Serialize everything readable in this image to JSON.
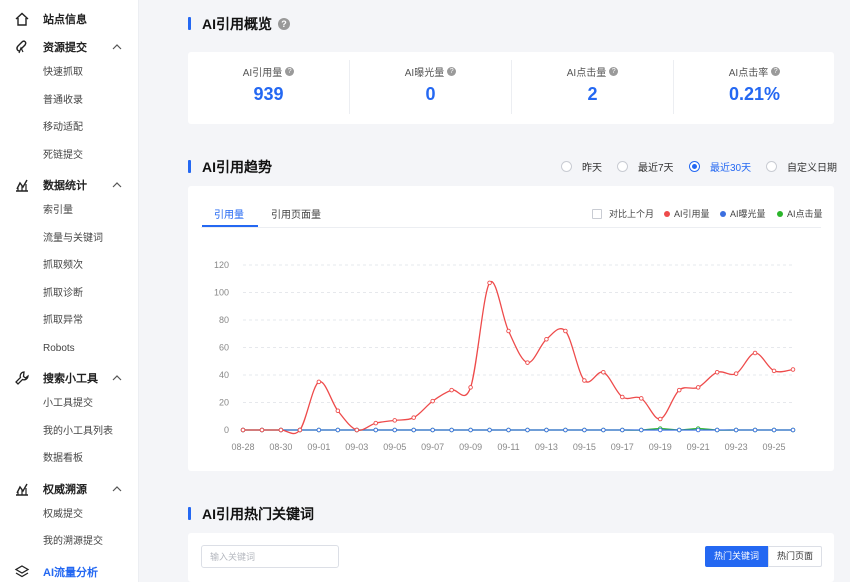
{
  "sidebar": {
    "groups": [
      {
        "label": "站点信息",
        "icon": "home-icon",
        "items": []
      },
      {
        "label": "资源提交",
        "icon": "submit-icon",
        "items": [
          "快速抓取",
          "普通收录",
          "移动适配",
          "死链提交"
        ]
      },
      {
        "label": "数据统计",
        "icon": "stats-icon",
        "items": [
          "索引量",
          "流量与关键词",
          "抓取频次",
          "抓取诊断",
          "抓取异常",
          "Robots"
        ]
      },
      {
        "label": "搜索小工具",
        "icon": "wrench-icon",
        "items": [
          "小工具提交",
          "我的小工具列表",
          "数据看板"
        ]
      },
      {
        "label": "权威溯源",
        "icon": "trace-icon",
        "items": [
          "权威提交",
          "我的溯源提交"
        ]
      },
      {
        "label": "AI流量分析",
        "icon": "layers-icon",
        "items": []
      }
    ]
  },
  "overview": {
    "title": "AI引用概览",
    "stats": [
      {
        "label": "AI引用量",
        "value": "939"
      },
      {
        "label": "AI曝光量",
        "value": "0"
      },
      {
        "label": "AI点击量",
        "value": "2"
      },
      {
        "label": "AI点击率",
        "value": "0.21%"
      }
    ]
  },
  "trend": {
    "title": "AI引用趋势",
    "ranges": [
      "昨天",
      "最近7天",
      "最近30天",
      "自定义日期"
    ],
    "selected_range": "最近30天",
    "tabs": [
      "引用量",
      "引用页面量"
    ],
    "active_tab": "引用量",
    "compare_label": "对比上个月",
    "legend": [
      {
        "name": "AI引用量",
        "color": "#ee4b4b"
      },
      {
        "name": "AI曝光量",
        "color": "#3b6fe0"
      },
      {
        "name": "AI点击量",
        "color": "#2bb52b"
      }
    ]
  },
  "chart_data": {
    "type": "line",
    "x": [
      "08-28",
      "08-29",
      "08-30",
      "08-31",
      "09-01",
      "09-02",
      "09-03",
      "09-04",
      "09-05",
      "09-06",
      "09-07",
      "09-08",
      "09-09",
      "09-10",
      "09-11",
      "09-12",
      "09-13",
      "09-14",
      "09-15",
      "09-16",
      "09-17",
      "09-18",
      "09-19",
      "09-20",
      "09-21",
      "09-22",
      "09-23",
      "09-24",
      "09-25",
      "09-26"
    ],
    "x_tick_labels": [
      "08-28",
      "08-30",
      "09-01",
      "09-03",
      "09-05",
      "09-07",
      "09-09",
      "09-11",
      "09-13",
      "09-15",
      "09-17",
      "09-19",
      "09-21",
      "09-23",
      "09-25"
    ],
    "y_ticks": [
      0,
      20,
      40,
      60,
      80,
      100,
      120
    ],
    "ylim": [
      0,
      120
    ],
    "grid": true,
    "series": [
      {
        "name": "AI引用量",
        "color": "#ee4b4b",
        "values": [
          0,
          0,
          0,
          0,
          35,
          14,
          0,
          5,
          7,
          9,
          21,
          29,
          31,
          107,
          72,
          49,
          66,
          72,
          36,
          42,
          24,
          23,
          8,
          29,
          31,
          42,
          41,
          56,
          43,
          44
        ]
      },
      {
        "name": "AI曝光量",
        "color": "#3b6fe0",
        "values": [
          0,
          0,
          0,
          0,
          0,
          0,
          0,
          0,
          0,
          0,
          0,
          0,
          0,
          0,
          0,
          0,
          0,
          0,
          0,
          0,
          0,
          0,
          0,
          0,
          0,
          0,
          0,
          0,
          0,
          0
        ]
      },
      {
        "name": "AI点击量",
        "color": "#2bb52b",
        "values": [
          0,
          0,
          0,
          0,
          0,
          0,
          0,
          0,
          0,
          0,
          0,
          0,
          0,
          0,
          0,
          0,
          0,
          0,
          0,
          0,
          0,
          0,
          1,
          0,
          1,
          0,
          0,
          0,
          0,
          0
        ]
      }
    ]
  },
  "keywords": {
    "title": "AI引用热门关键词",
    "search_placeholder": "输入关键词",
    "search_value": "",
    "toggle": [
      "热门关键词",
      "热门页面"
    ],
    "active_toggle": "热门关键词"
  }
}
